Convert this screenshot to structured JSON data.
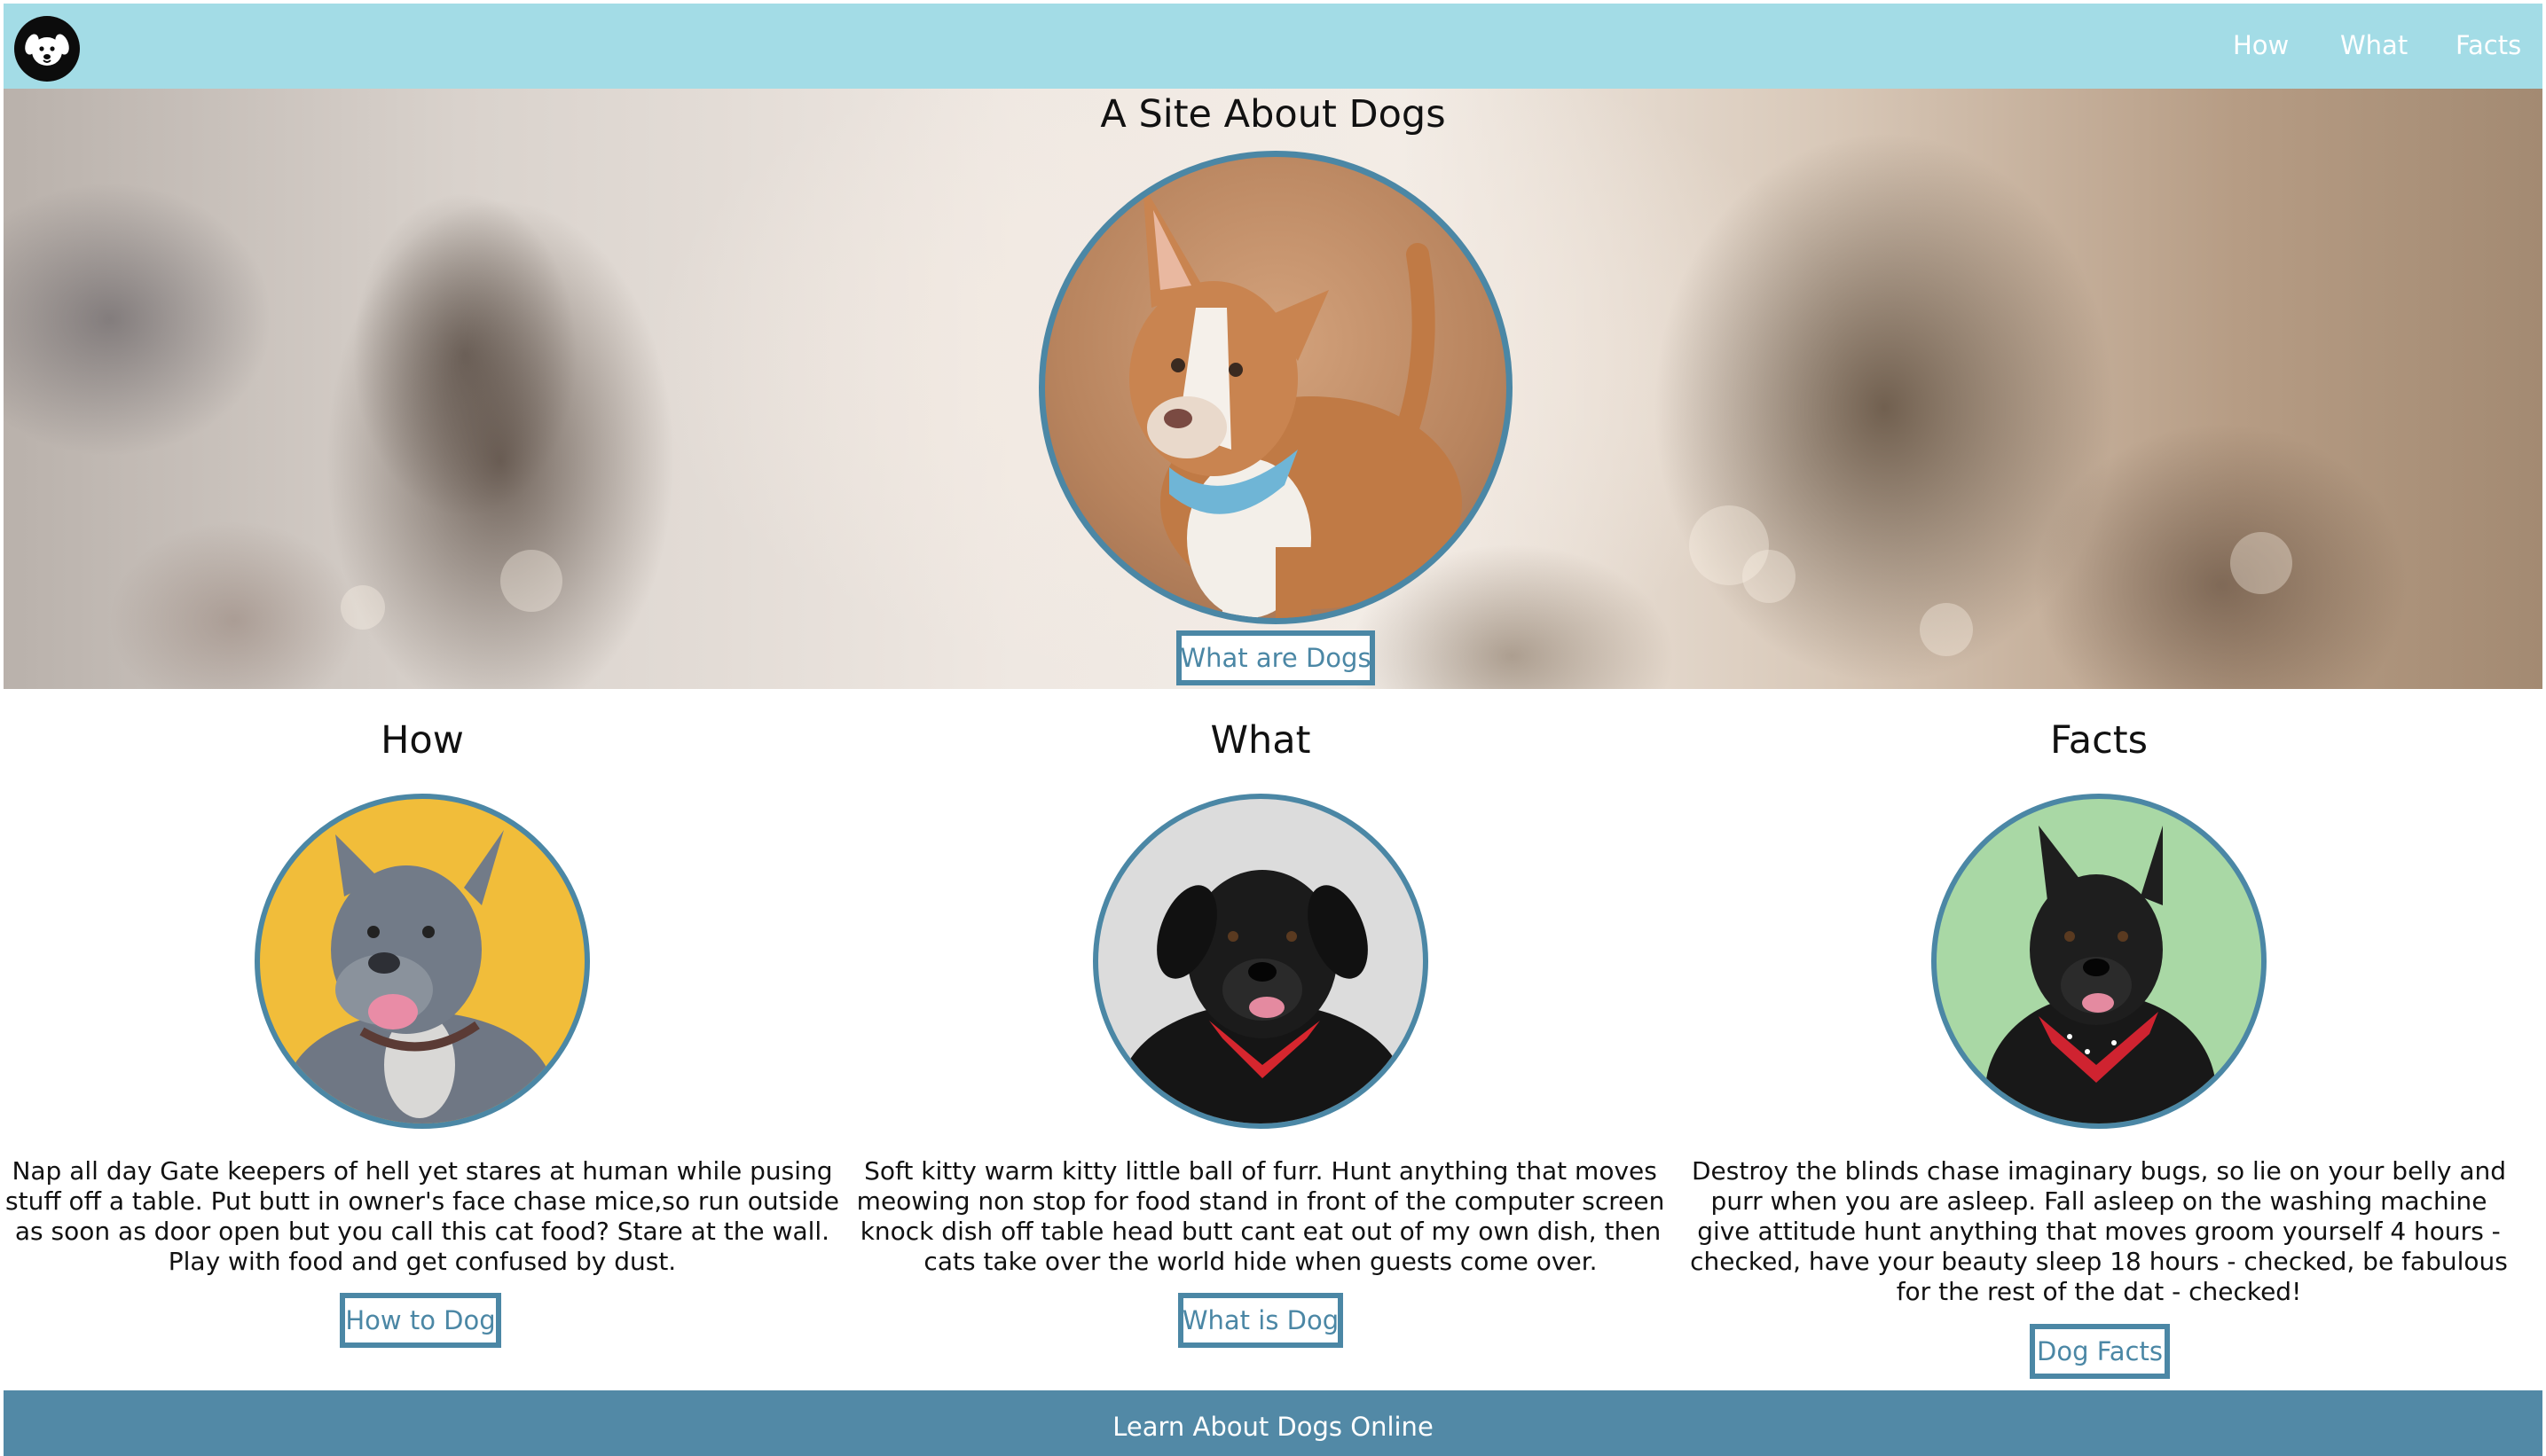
{
  "nav": {
    "logo_icon": "dog-face-icon",
    "links": [
      "How",
      "What",
      "Facts"
    ]
  },
  "hero": {
    "title": "A Site About Dogs",
    "button_label": "What are Dogs",
    "portrait": "tan-pitbull-blue-bandana"
  },
  "sections": [
    {
      "heading": "How",
      "portrait": "grey-pitbull-yellow-background",
      "text": "Nap all day Gate keepers of hell yet stares at human while pusing stuff off a table. Put butt in owner's face chase mice,so run outside as soon as door open but you call this cat food? Stare at the wall. Play with food and get confused by dust.",
      "button_label": "How to Dog"
    },
    {
      "heading": "What",
      "portrait": "black-lab-red-bandana-grey-background",
      "text": "Soft kitty warm kitty little ball of furr. Hunt anything that moves meowing non stop for food stand in front of the computer screen knock dish off table head butt cant eat out of my own dish, then cats take over the world hide when guests come over.",
      "button_label": "What is Dog"
    },
    {
      "heading": "Facts",
      "portrait": "black-dog-red-bandana-green-background",
      "text": "Destroy the blinds chase imaginary bugs, so lie on your belly and purr when you are asleep. Fall asleep on the washing machine give attitude hunt anything that moves groom yourself 4 hours - checked, have your beauty sleep 18 hours - checked, be fabulous for the rest of the dat - checked!",
      "button_label": "Dog Facts"
    }
  ],
  "footer": {
    "text": "Learn About Dogs Online"
  },
  "colors": {
    "navbar_bg": "#a3dce6",
    "accent_blue": "#4b87a5",
    "footer_bg": "#5289a6"
  }
}
